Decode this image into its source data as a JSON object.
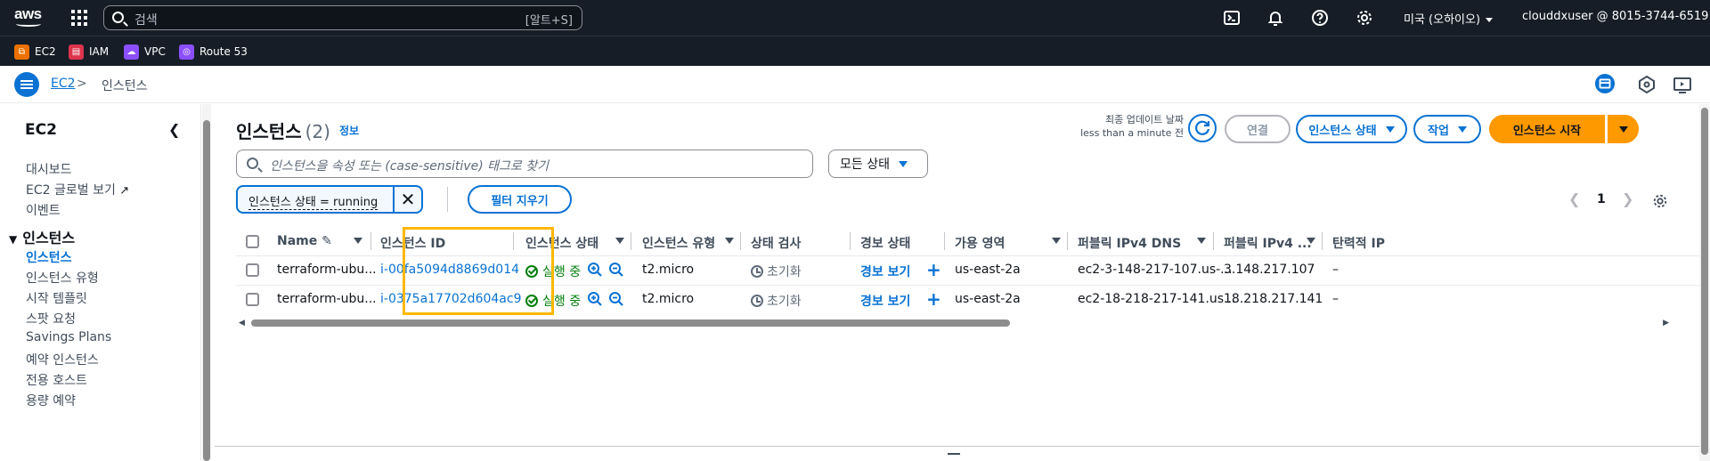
{
  "topnav": {
    "logo": "aws",
    "search_placeholder": "검색",
    "search_shortcut": "[알트+S]",
    "region": "미국 (오하이오)",
    "account": "clouddxuser @ 8015-3744-6519",
    "icons": [
      "cloudshell-icon",
      "bell-icon",
      "help-icon",
      "gear-icon"
    ]
  },
  "favorites": [
    {
      "label": "EC2",
      "color": "#ed7100"
    },
    {
      "label": "IAM",
      "color": "#dd344c"
    },
    {
      "label": "VPC",
      "color": "#8c4fff"
    },
    {
      "label": "Route 53",
      "color": "#8c4fff"
    }
  ],
  "breadcrumb": {
    "root": "EC2",
    "separator": ">",
    "current": "인스턴스"
  },
  "sidebar": {
    "title": "EC2",
    "items_top": [
      "대시보드",
      "EC2 글로벌 보기",
      "이벤트"
    ],
    "section": "인스턴스",
    "section_items": [
      "인스턴스",
      "인스턴스 유형",
      "시작 템플릿",
      "스팟 요청",
      "Savings Plans",
      "예약 인스턴스",
      "전용 호스트",
      "용량 예약"
    ]
  },
  "header": {
    "title": "인스턴스",
    "count": "(2)",
    "info": "정보",
    "last_update_label": "최종 업데이트 날짜",
    "last_update_value": "less than a minute 전",
    "connect_btn": "연결",
    "state_btn": "인스턴스 상태",
    "actions_btn": "작업",
    "launch_btn": "인스턴스 시작"
  },
  "filter": {
    "placeholder": "인스턴스을 속성 또는 (case-sensitive) 태그로 찾기",
    "state_select": "모든 상태",
    "token": "인스턴스 상태 = running",
    "clear_btn": "필터 지우기"
  },
  "pager": {
    "page": "1"
  },
  "table": {
    "columns": [
      "Name",
      "인스턴스 ID",
      "인스턴스 상태",
      "인스턴스 유형",
      "상태 검사",
      "경보 상태",
      "가용 영역",
      "퍼블릭 IPv4 DNS",
      "퍼블릭 IPv4 ...",
      "탄력적 IP"
    ],
    "rows": [
      {
        "name": "terraform-ubu...",
        "id": "i-00fa5094d8869d014",
        "state": "실행 중",
        "type": "t2.micro",
        "check": "초기화",
        "alarm": "경보 보기",
        "az": "us-east-2a",
        "dns": "ec2-3-148-217-107.us-...",
        "ip": "3.148.217.107",
        "eip": "–"
      },
      {
        "name": "terraform-ubu...",
        "id": "i-0375a17702d604ac9",
        "state": "실행 중",
        "type": "t2.micro",
        "check": "초기화",
        "alarm": "경보 보기",
        "az": "us-east-2a",
        "dns": "ec2-18-218-217-141.us...",
        "ip": "18.218.217.141",
        "eip": "–"
      }
    ]
  },
  "colors": {
    "primary": "#0972d3",
    "launch": "#ff9900",
    "nav_bg": "#161d26",
    "running": "#037f0c",
    "highlight": "#ffb800"
  }
}
